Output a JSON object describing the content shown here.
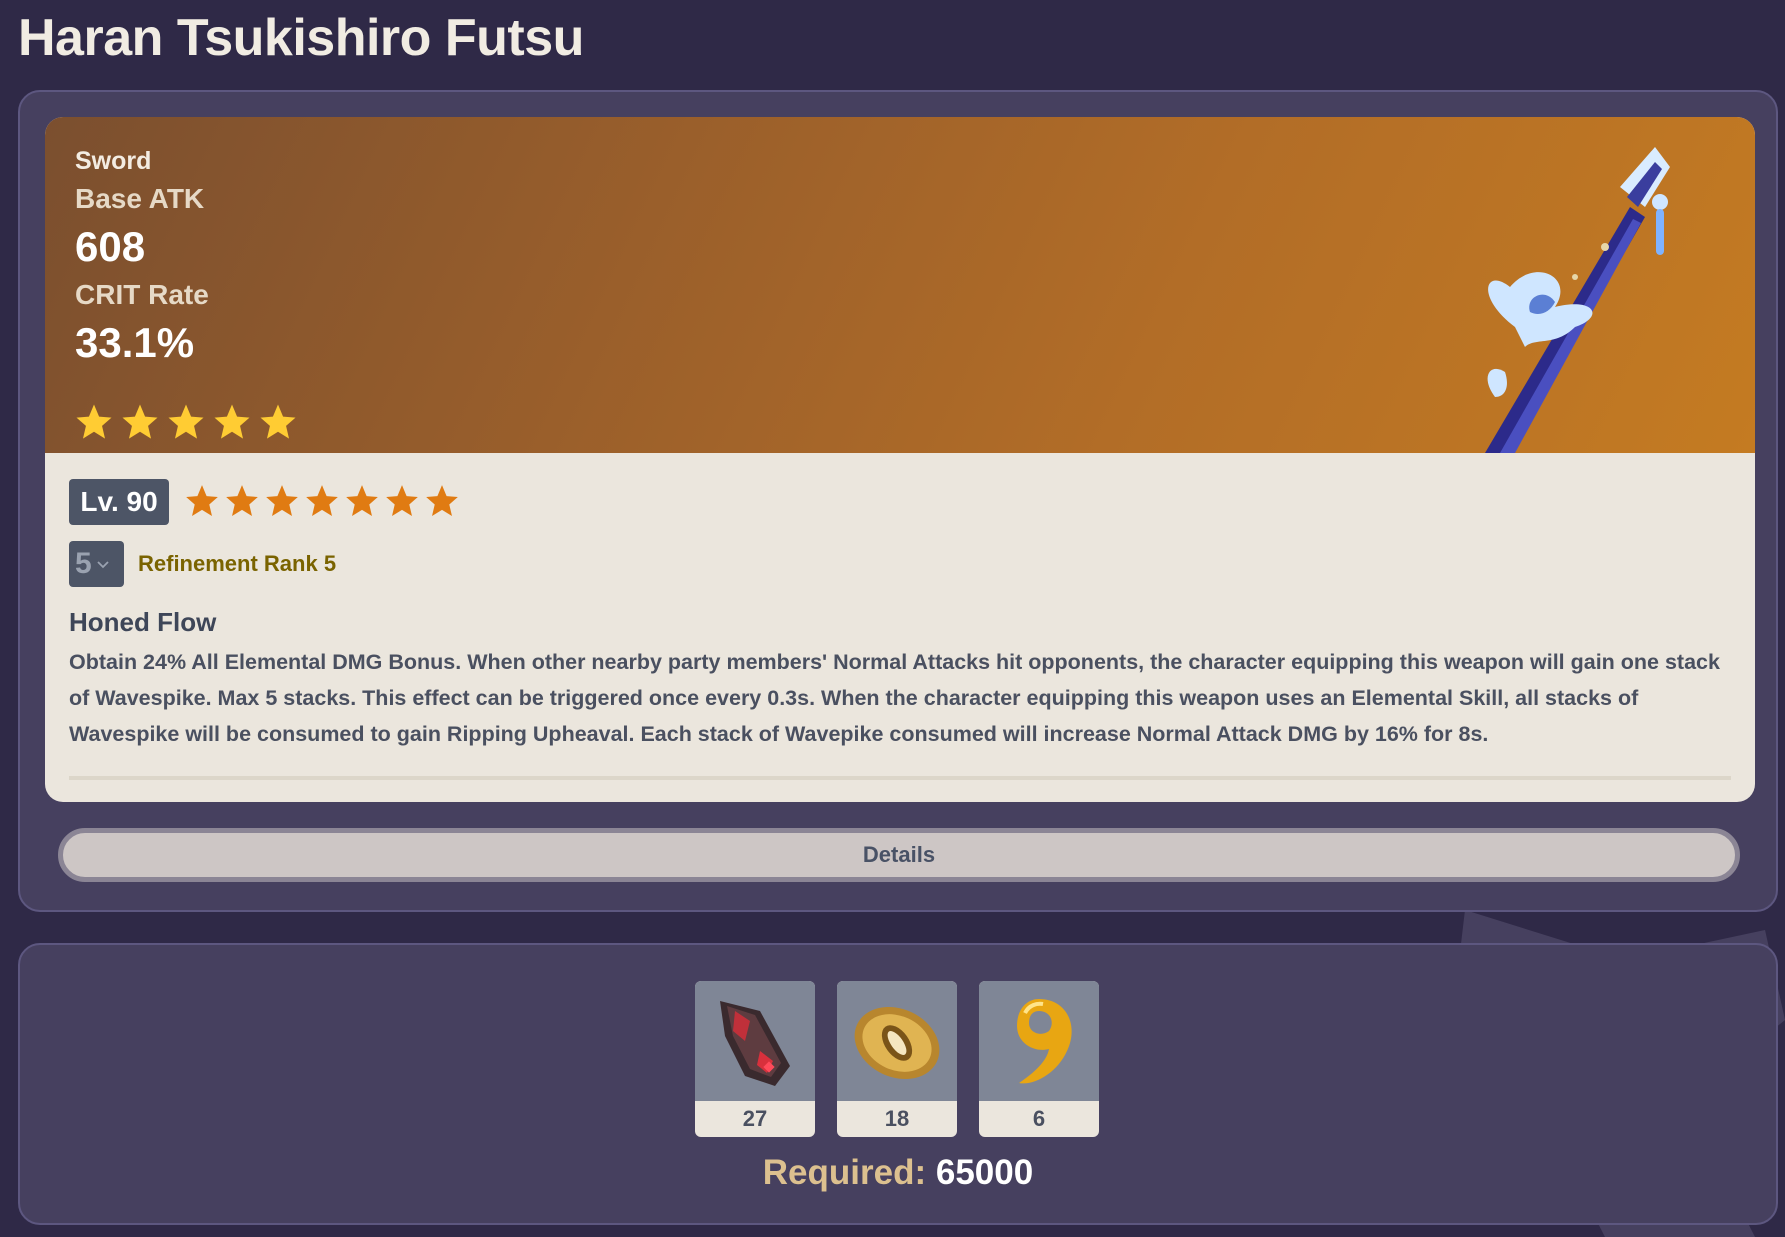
{
  "page": {
    "title": "Haran Tsukishiro Futsu"
  },
  "weapon": {
    "type": "Sword",
    "base_atk_label": "Base ATK",
    "base_atk_value": "608",
    "substat_label": "CRIT Rate",
    "substat_value": "33.1%",
    "rarity": 5,
    "art_icon": "sword-weapon-art"
  },
  "level": {
    "label": "Lv. 90",
    "ascension_stars": 7
  },
  "refinement": {
    "selected_value": "5",
    "label": "Refinement Rank 5"
  },
  "passive": {
    "name": "Honed Flow",
    "description": "Obtain 24% All Elemental DMG Bonus. When other nearby party members' Normal Attacks hit opponents, the character equipping this weapon will gain one stack of Wavespike. Max 5 stacks. This effect can be triggered once every 0.3s. When the character equipping this weapon uses an Elemental Skill, all stacks of Wavespike will be consumed to gain Ripping Upheaval. Each stack of Wavepike consumed will increase Normal Attack DMG by 16% for 8s."
  },
  "details_button": {
    "label": "Details"
  },
  "materials": {
    "items": [
      {
        "icon": "crimson-crystal-material-icon",
        "count": "27"
      },
      {
        "icon": "golden-guard-material-icon",
        "count": "18"
      },
      {
        "icon": "golden-spiral-material-icon",
        "count": "6"
      }
    ],
    "required_label": "Required:",
    "required_value": "65000"
  },
  "colors": {
    "background": "#2f2947",
    "panel": "#46405f",
    "card": "#ebe6dd",
    "header_gradient_start": "#7b4f2f",
    "header_gradient_end": "#c47b22",
    "rarity_star": "#ffcc33",
    "ascension_star": "#e07b12",
    "refinement_text": "#7a6300",
    "required_label": "#dcc08f"
  }
}
